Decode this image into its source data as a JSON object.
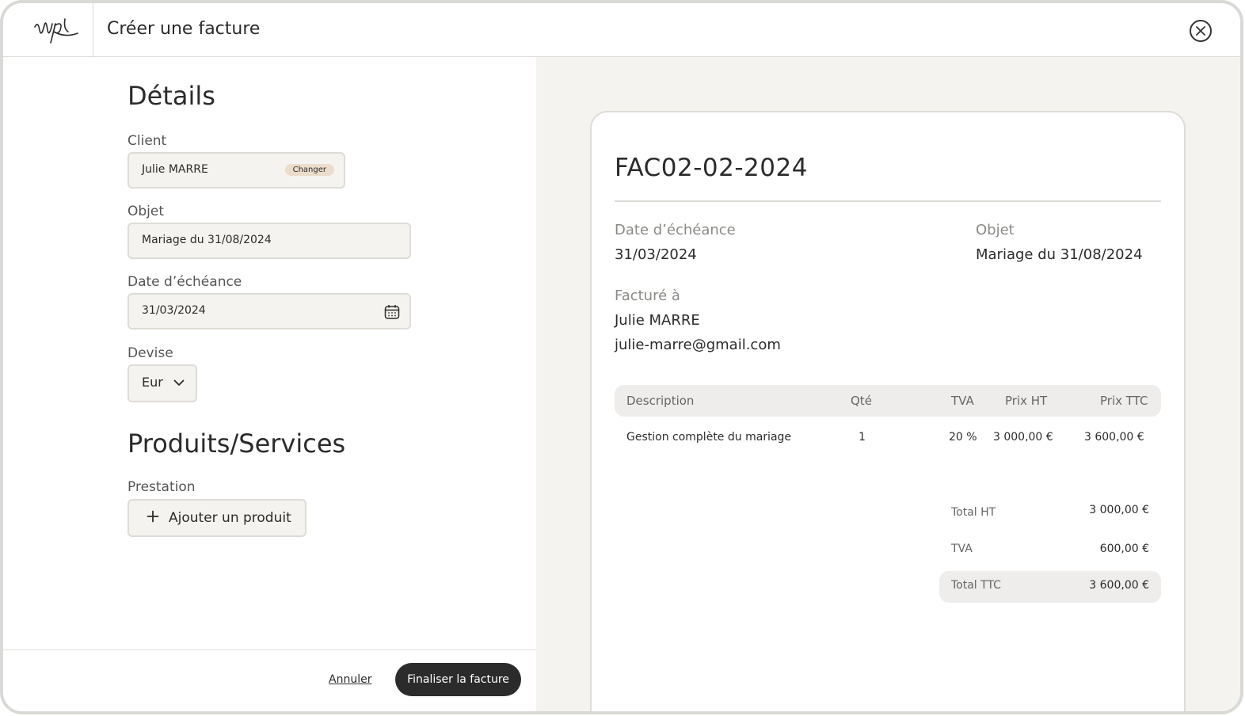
{
  "header": {
    "title": "Créer une facture"
  },
  "form": {
    "details_heading": "Détails",
    "client_label": "Client",
    "client_value": "Julie MARRE",
    "client_change": "Changer",
    "object_label": "Objet",
    "object_value": "Mariage du 31/08/2024",
    "due_label": "Date d’échéance",
    "due_value": "31/03/2024",
    "currency_label": "Devise",
    "currency_value": "Eur",
    "products_heading": "Produits/Services",
    "prestation_label": "Prestation",
    "add_product": "Ajouter un produit"
  },
  "footer": {
    "cancel": "Annuler",
    "finalize": "Finaliser la facture"
  },
  "invoice": {
    "number": "FAC02-02-2024",
    "due_label": "Date d’échéance",
    "due_value": "31/03/2024",
    "object_label": "Objet",
    "object_value": "Mariage du 31/08/2024",
    "billed_label": "Facturé à",
    "billed_name": "Julie MARRE",
    "billed_email": "julie-marre@gmail.com",
    "columns": {
      "description": "Description",
      "qty": "Qté",
      "vat": "TVA",
      "price_ht": "Prix HT",
      "price_ttc": "Prix TTC"
    },
    "rows": [
      {
        "description": "Gestion complète du mariage",
        "qty": "1",
        "vat": "20 %",
        "price_ht": "3 000,00 €",
        "price_ttc": "3 600,00 €"
      }
    ],
    "totals": {
      "ht_label": "Total HT",
      "ht_value": "3 000,00 €",
      "vat_label": "TVA",
      "vat_value": "600,00 €",
      "ttc_label": "Total TTC",
      "ttc_value": "3 600,00 €"
    }
  },
  "icons": {
    "logo": "wp-signature-logo",
    "close": "close-circle-icon",
    "calendar": "calendar-icon",
    "chevron": "chevron-down-icon",
    "plus": "plus-icon"
  }
}
